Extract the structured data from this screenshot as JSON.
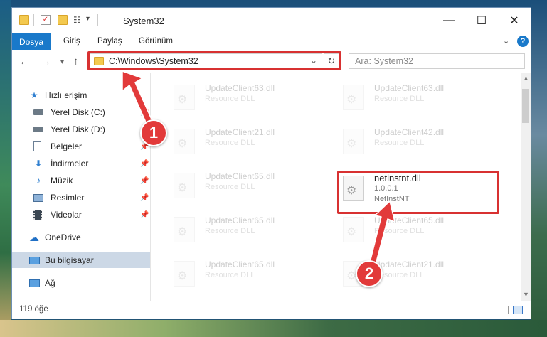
{
  "window": {
    "title": "System32",
    "minimize_icon": "—",
    "maximize_icon": "☐",
    "close_icon": "✕"
  },
  "ribbon": {
    "tabs": [
      "Dosya",
      "Giriş",
      "Paylaş",
      "Görünüm"
    ],
    "help": "?"
  },
  "address": {
    "path": "C:\\Windows\\System32",
    "search_placeholder": "Ara: System32"
  },
  "sidebar": {
    "items": [
      {
        "label": "Hızlı erişim",
        "icon": "star-icon"
      },
      {
        "label": "Yerel Disk (C:)",
        "icon": "drive-icon"
      },
      {
        "label": "Yerel Disk (D:)",
        "icon": "drive-icon"
      },
      {
        "label": "Belgeler",
        "icon": "documents-icon"
      },
      {
        "label": "İndirmeler",
        "icon": "download-icon"
      },
      {
        "label": "Müzik",
        "icon": "music-icon"
      },
      {
        "label": "Resimler",
        "icon": "pictures-icon"
      },
      {
        "label": "Videolar",
        "icon": "videos-icon"
      },
      {
        "label": "OneDrive",
        "icon": "cloud-icon"
      },
      {
        "label": "Bu bilgisayar",
        "icon": "computer-icon"
      },
      {
        "label": "Ağ",
        "icon": "network-icon"
      }
    ]
  },
  "files": [
    {
      "name": "UpdateClient63.dll",
      "type": "Resource DLL"
    },
    {
      "name": "UpdateClient63.dll",
      "type": "Resource DLL"
    },
    {
      "name": "UpdateClient21.dll",
      "type": "Resource DLL"
    },
    {
      "name": "UpdateClient42.dll",
      "type": "Resource DLL"
    },
    {
      "name": "UpdateClient65.dll",
      "type": "Resource DLL"
    },
    {
      "name": "netinstnt.dll",
      "version": "1.0.0.1",
      "type": "NetInstNT"
    },
    {
      "name": "UpdateClient65.dll",
      "type": "Resource DLL"
    },
    {
      "name": "UpdateClient65.dll",
      "type": "Resource DLL"
    },
    {
      "name": "UpdateClient65.dll",
      "type": "Resource DLL"
    },
    {
      "name": "UpdateClient21.dll",
      "type": "Resource DLL"
    }
  ],
  "status": {
    "item_count": "119 öğe"
  },
  "annotations": {
    "step1": "1",
    "step2": "2",
    "color": "#d83131"
  }
}
